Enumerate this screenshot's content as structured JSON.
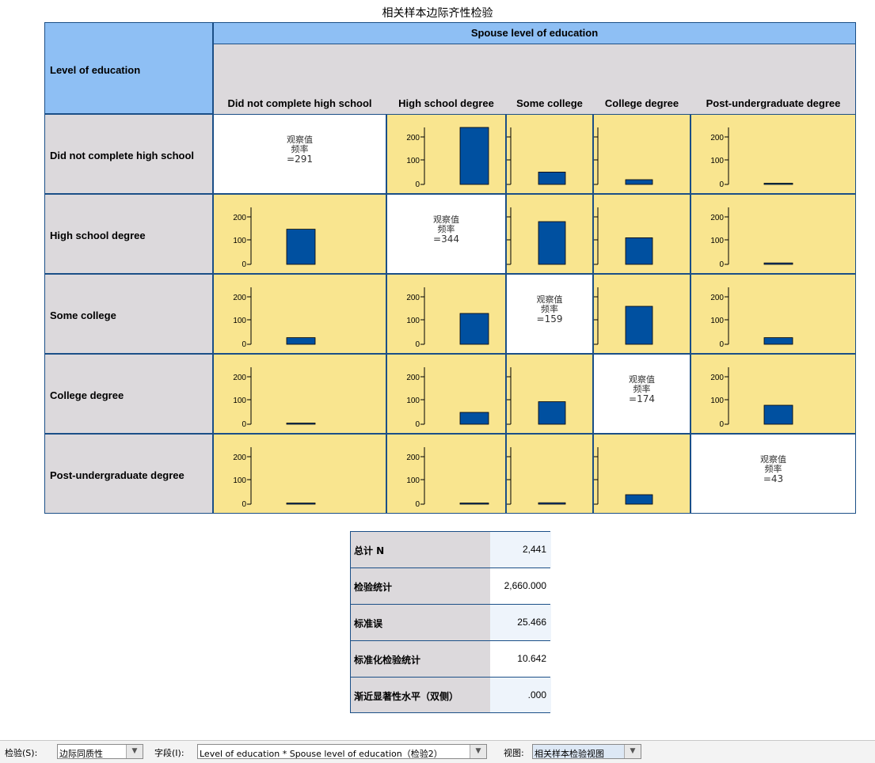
{
  "title": "相关样本边际齐性检验",
  "matrix": {
    "row_header_title": "Level of education",
    "col_header_title": "Spouse level of education",
    "columns": [
      "Did not complete high school",
      "High school degree",
      "Some college",
      "College degree",
      "Post-undergraduate degree"
    ],
    "rows": [
      "Did not complete high school",
      "High school degree",
      "Some college",
      "College degree",
      "Post-undergraduate degree"
    ],
    "tick_labels": [
      "200",
      "100",
      "0"
    ],
    "tick_labels_clipped": [
      "00",
      "00",
      "0"
    ],
    "diag_label_1": "观察值",
    "diag_label_2": "频率",
    "diagonal_values": [
      "=291",
      "=344",
      "=159",
      "=174",
      "=43"
    ]
  },
  "chart_data": {
    "type": "bar",
    "title": "相关样本边际齐性检验",
    "xlabel": "Spouse level of education",
    "ylabel": "Level of education",
    "ylim": [
      0,
      250
    ],
    "note_values": "off-diagonal cells show observed frequency bar; null = diagonal cell",
    "categories": [
      "Did not complete high school",
      "High school degree",
      "Some college",
      "College degree",
      "Post-undergraduate degree"
    ],
    "series": [
      {
        "name": "Did not complete high school",
        "values": [
          291,
          240,
          52,
          20,
          1
        ]
      },
      {
        "name": "High school degree",
        "values": [
          148,
          344,
          180,
          112,
          6
        ]
      },
      {
        "name": "Some college",
        "values": [
          28,
          130,
          159,
          160,
          28
        ]
      },
      {
        "name": "College degree",
        "values": [
          1,
          50,
          95,
          174,
          80
        ]
      },
      {
        "name": "Post-undergraduate degree",
        "values": [
          1,
          4,
          6,
          40,
          43
        ]
      }
    ]
  },
  "stats": [
    {
      "label": "总计 N",
      "value": "2,441"
    },
    {
      "label": "检验统计",
      "value": "2,660.000"
    },
    {
      "label": "标准误",
      "value": "25.466"
    },
    {
      "label": "标准化检验统计",
      "value": "10.642"
    },
    {
      "label": "渐近显著性水平（双侧）",
      "value": ".000"
    }
  ],
  "bottombar": {
    "test_label": "检验(S):",
    "test_value": "边际同质性",
    "field_label": "字段(I):",
    "field_value": "Level of education * Spouse level of education（检验2）",
    "view_label": "视图:",
    "view_value": "相关样本检验视图"
  },
  "colors": {
    "header_blue": "#8ebff4",
    "cell_yellow": "#f9e58f",
    "bar": "#0050a0",
    "grey": "#dcd9dc"
  }
}
